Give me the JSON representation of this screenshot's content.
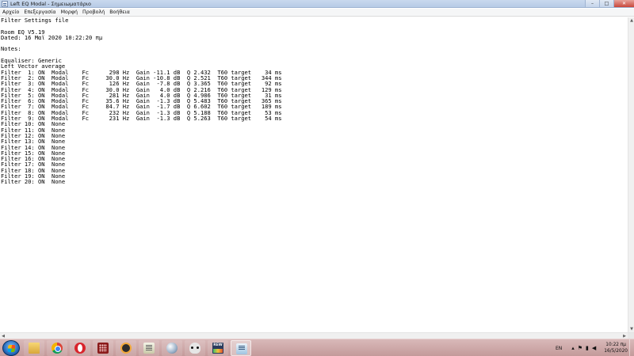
{
  "window": {
    "title": "Left EQ Modal - Σημειωματάριο",
    "minimize_glyph": "–",
    "maximize_glyph": "□",
    "close_glyph": "✕"
  },
  "menu": [
    {
      "label": "Αρχείο"
    },
    {
      "label": "Επεξεργασία"
    },
    {
      "label": "Μορφή"
    },
    {
      "label": "Προβολή"
    },
    {
      "label": "Βοήθεια"
    }
  ],
  "document": {
    "lines": [
      "Filter Settings file",
      "",
      "Room EQ V5.19",
      "Dated: 16 Μαϊ 2020 10:22:20 πμ",
      "",
      "Notes:",
      "",
      "Equaliser: Generic",
      "Left Vector average",
      "Filter  1: ON  Modal    Fc      298 Hz  Gain -11.1 dB  Q 2.432  T60 target    34 ms",
      "Filter  2: ON  Modal    Fc     30.0 Hz  Gain -10.8 dB  Q 2.521  T60 target   344 ms",
      "Filter  3: ON  Modal    Fc      126 Hz  Gain  -7.8 dB  Q 3.365  T60 target    92 ms",
      "Filter  4: ON  Modal    Fc     30.0 Hz  Gain   4.0 dB  Q 2.216  T60 target   129 ms",
      "Filter  5: ON  Modal    Fc      281 Hz  Gain   4.0 dB  Q 4.986  T60 target    31 ms",
      "Filter  6: ON  Modal    Fc     35.6 Hz  Gain  -1.3 dB  Q 5.483  T60 target   365 ms",
      "Filter  7: ON  Modal    Fc     84.7 Hz  Gain  -1.7 dB  Q 6.602  T60 target   189 ms",
      "Filter  8: ON  Modal    Fc      232 Hz  Gain  -1.3 dB  Q 5.188  T60 target    53 ms",
      "Filter  9: ON  Modal    Fc      231 Hz  Gain  -1.3 dB  Q 5.263  T60 target    54 ms",
      "Filter 10: ON  None",
      "Filter 11: ON  None",
      "Filter 12: ON  None",
      "Filter 13: ON  None",
      "Filter 14: ON  None",
      "Filter 15: ON  None",
      "Filter 16: ON  None",
      "Filter 17: ON  None",
      "Filter 18: ON  None",
      "Filter 19: ON  None",
      "Filter 20: ON  None"
    ]
  },
  "scrollbar": {
    "up_glyph": "▲",
    "down_glyph": "▼",
    "left_glyph": "◀",
    "right_glyph": "▶"
  },
  "taskbar": {
    "apps": [
      {
        "icon": "folder-icon"
      },
      {
        "icon": "chrome-icon"
      },
      {
        "icon": "opera-icon"
      },
      {
        "icon": "grid-app-icon"
      },
      {
        "icon": "owl-app-icon"
      },
      {
        "icon": "notepad-app-icon"
      },
      {
        "icon": "sphere-app-icon"
      },
      {
        "icon": "alien-app-icon"
      },
      {
        "icon": "rew-icon",
        "label": "REW"
      },
      {
        "icon": "notepad-active-icon"
      }
    ],
    "tray": {
      "language": "EN",
      "icons": [
        "chevron-up-icon",
        "flag-icon",
        "network-icon",
        "volume-icon"
      ],
      "icon_glyphs": [
        "▴",
        "⚑",
        "▮",
        "◀"
      ],
      "time": "10:22 πμ",
      "date": "16/5/2020"
    }
  }
}
